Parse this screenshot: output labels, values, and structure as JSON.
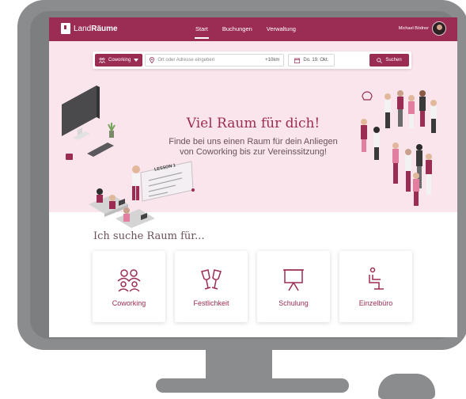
{
  "navbar": {
    "brand_prefix": "Land",
    "brand_bold": "Räume",
    "links": [
      {
        "label": "Start",
        "active": true
      },
      {
        "label": "Buchungen",
        "active": false
      },
      {
        "label": "Verwaltung",
        "active": false
      }
    ],
    "user_name": "Michael Bödner"
  },
  "search": {
    "space_type": "Coworking",
    "location_placeholder": "Ort oder Adresse eingeben",
    "radius": "+10km",
    "date": "Do. 19. Okt.",
    "submit_label": "Suchen"
  },
  "hero": {
    "title": "Viel Raum für dich!",
    "subtitle": "Finde bei uns einen Raum für dein Anliegen von Coworking bis zur Vereinssitzung!",
    "board_text": "LESSON 1"
  },
  "categories": {
    "title": "Ich suche Raum für...",
    "items": [
      {
        "label": "Coworking",
        "icon": "people-icon"
      },
      {
        "label": "Festlichkeit",
        "icon": "champagne-glasses-icon"
      },
      {
        "label": "Schulung",
        "icon": "presentation-board-icon"
      },
      {
        "label": "Einzelbüro",
        "icon": "desk-chair-icon"
      }
    ]
  },
  "colors": {
    "brand": "#9b2c53",
    "hero_bg": "#fbe5ec",
    "frame": "#8a8c8e"
  }
}
